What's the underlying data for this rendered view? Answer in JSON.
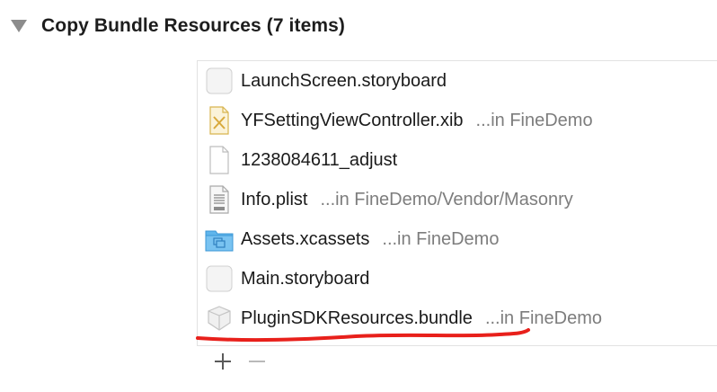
{
  "section": {
    "title": "Copy Bundle Resources (7 items)"
  },
  "files": [
    {
      "name": "LaunchScreen.storyboard",
      "location": "",
      "icon": "storyboard-icon"
    },
    {
      "name": "YFSettingViewController.xib",
      "location": "...in FineDemo",
      "icon": "xib-icon"
    },
    {
      "name": "1238084611_adjust",
      "location": "",
      "icon": "blank-file-icon"
    },
    {
      "name": "Info.plist",
      "location": "...in FineDemo/Vendor/Masonry",
      "icon": "plist-icon"
    },
    {
      "name": "Assets.xcassets",
      "location": "...in FineDemo",
      "icon": "asset-folder-icon"
    },
    {
      "name": "Main.storyboard",
      "location": "",
      "icon": "storyboard-icon"
    },
    {
      "name": "PluginSDKResources.bundle",
      "location": "...in FineDemo",
      "icon": "bundle-icon"
    }
  ],
  "toolbar": {
    "add_label": "+",
    "remove_label": "−"
  },
  "colors": {
    "annotation": "#e8201b",
    "folder_blue": "#5fb5ec",
    "xib_yellow": "#e9c46a"
  }
}
